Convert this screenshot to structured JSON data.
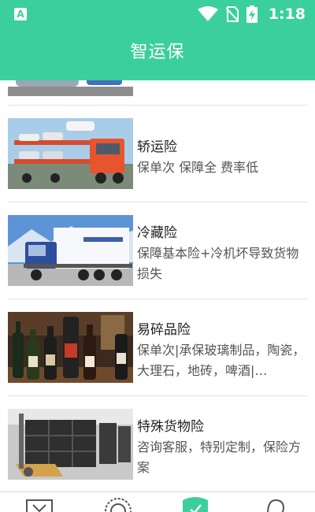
{
  "status_bar": {
    "app_icon_letter": "A",
    "time": "1:18",
    "icons": [
      "wifi-icon",
      "no-sim-icon",
      "battery-charging-icon"
    ]
  },
  "header": {
    "title": "智运保"
  },
  "items": [
    {
      "name": "",
      "desc": "",
      "image": "car-image-partial"
    },
    {
      "name": "轿运险",
      "desc": "保单次 保障全 费率低",
      "image": "car-carrier-truck-image"
    },
    {
      "name": "冷藏险",
      "desc": "保障基本险+冷机坏导致货物损失",
      "image": "refrigerated-truck-image"
    },
    {
      "name": "易碎品险",
      "desc": "保单次|承保玻璃制品，陶瓷，大理石，地砖，啤酒|…",
      "image": "wine-bottles-image"
    },
    {
      "name": "特殊货物险",
      "desc": "咨询客服，特别定制，保险方案",
      "image": "wooden-crates-image"
    }
  ],
  "bottom_nav": [
    {
      "icon": "box-icon"
    },
    {
      "icon": "compass-icon"
    },
    {
      "icon": "shield-check-icon",
      "active": true
    },
    {
      "icon": "user-icon"
    }
  ],
  "colors": {
    "accent": "#3ccf9e",
    "text": "#222222",
    "subtext": "#555555",
    "divider": "#e4e4e4"
  }
}
